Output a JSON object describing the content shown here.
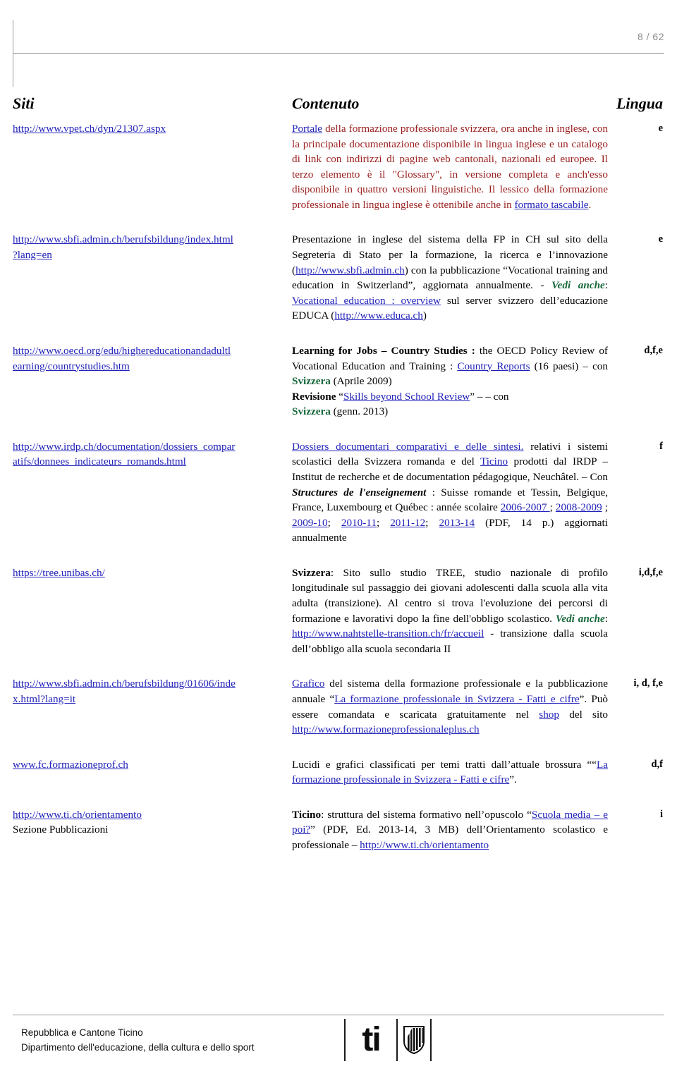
{
  "header": {
    "page_number": "8 / 62"
  },
  "table": {
    "columns": [
      "Siti",
      "Contenuto",
      "Lingua"
    ],
    "rows": [
      {
        "site": "http://www.vpet.ch/dyn/21307.aspx",
        "site_extra": "",
        "lingua": "e",
        "content_text": "Portale della formazione professionale svizzera, ora anche in inglese, con la principale documentazione disponibile in lingua inglese e un catalogo di link con indirizzi di pagine web cantonali, nazionali ed europee. Il terzo elemento è il \"Glossary\", in versione completa e anch'esso disponibile in quattro versioni linguistiche. Il lessico della formazione professionale in lingua inglese è ottenibile anche in formato tascabile.",
        "fragments": [
          {
            "t": "Portale",
            "s": "link"
          },
          {
            "t": " della formazione professionale svizzera, ora anche in inglese, con la principale documentazione disponibile in lingua inglese e un catalogo di link con indirizzi di pagine web cantonali, nazionali ed europee. Il terzo elemento è il \"Glossary\", in versione completa e anch'esso disponibile in quattro versioni linguistiche. Il lessico della formazione professionale in lingua inglese è ottenibile anche in ",
            "s": "red"
          },
          {
            "t": "formato tascabile",
            "s": "link"
          },
          {
            "t": ".",
            "s": "red"
          }
        ]
      },
      {
        "site": "http://www.sbfi.admin.ch/berufsbildung/index.html",
        "site_extra": "?lang=en",
        "lingua": "e",
        "fragments": [
          {
            "t": "Presentazione in inglese del sistema della FP in CH sul sito della Segreteria di Stato per la formazione, la ricerca e l’innovazione (",
            "s": "plain"
          },
          {
            "t": "http://www.sbfi.admin.ch",
            "s": "link"
          },
          {
            "t": ") con la pubblicazione “Vocational training and education in Switzerland”, aggiornata annualmente. - ",
            "s": "plain"
          },
          {
            "t": "Vedi anche",
            "s": "green-italic"
          },
          {
            "t": ": ",
            "s": "plain"
          },
          {
            "t": "Vocational education : overview",
            "s": "link"
          },
          {
            "t": " sul server svizzero dell’educazione EDUCA (",
            "s": "plain"
          },
          {
            "t": "http://www.educa.ch",
            "s": "link"
          },
          {
            "t": ")",
            "s": "plain"
          }
        ]
      },
      {
        "site": "http://www.oecd.org/edu/highereducationandadultl",
        "site_extra": "earning/countrystudies.htm",
        "lingua": "d,f,e",
        "fragments": [
          {
            "t": "Learning for Jobs – Country Studies :",
            "s": "bold"
          },
          {
            "t": " the OECD Policy Review of Vocational Education and Training : ",
            "s": "plain"
          },
          {
            "t": "Country Reports",
            "s": "link"
          },
          {
            "t": " (16 paesi)  – con ",
            "s": "plain"
          },
          {
            "t": "Svizzera",
            "s": "green-bold"
          },
          {
            "t": " (Aprile 2009)",
            "s": "plain"
          },
          {
            "t": "BR",
            "s": "br"
          },
          {
            "t": "Revisione ",
            "s": "bold"
          },
          {
            "t": "“",
            "s": "plain"
          },
          {
            "t": "Skills beyond School Review",
            "s": "link"
          },
          {
            "t": "” – – con ",
            "s": "plain"
          },
          {
            "t": "BR",
            "s": "br"
          },
          {
            "t": "Svizzera",
            "s": "green-bold"
          },
          {
            "t": " (genn. 2013)",
            "s": "plain"
          }
        ]
      },
      {
        "site": "http://www.irdp.ch/documentation/dossiers_compar",
        "site_extra": "atifs/donnees_indicateurs_romands.html",
        "lingua": "f",
        "fragments": [
          {
            "t": "Dossiers documentari comparativi e delle sintesi.",
            "s": "link"
          },
          {
            "t": " relativi i sistemi scolastici della Svizzera romanda e del ",
            "s": "plain"
          },
          {
            "t": "Ticino",
            "s": "link"
          },
          {
            "t": " prodotti dal IRDP – Institut de recherche et de documentation pédagogique, Neuchâtel. – Con ",
            "s": "plain"
          },
          {
            "t": "Structures de l'enseignement",
            "s": "bold-italic"
          },
          {
            "t": " : Suisse romande et Tessin, Belgique, France, Luxembourg et Québec : année scolaire ",
            "s": "plain"
          },
          {
            "t": "2006-2007 ",
            "s": "link"
          },
          {
            "t": "; ",
            "s": "plain"
          },
          {
            "t": "2008-2009",
            "s": "link"
          },
          {
            "t": " ; ",
            "s": "plain"
          },
          {
            "t": "2009-10",
            "s": "link"
          },
          {
            "t": "; ",
            "s": "plain"
          },
          {
            "t": "2010-11",
            "s": "link"
          },
          {
            "t": "; ",
            "s": "plain"
          },
          {
            "t": "2011-12",
            "s": "link"
          },
          {
            "t": "; ",
            "s": "plain"
          },
          {
            "t": "2013-14",
            "s": "link"
          },
          {
            "t": " (PDF, 14 p.) aggiornati annualmente",
            "s": "plain"
          }
        ]
      },
      {
        "site": "https://tree.unibas.ch/",
        "site_extra": "",
        "lingua": "i,d,f,e",
        "fragments": [
          {
            "t": "Svizzera",
            "s": "bold"
          },
          {
            "t": ": Sito sullo studio TREE, studio nazionale di profilo longitudinale sul passaggio dei giovani adolescenti dalla scuola alla vita adulta (transizione). Al centro si trova l'evoluzione dei percorsi di formazione e lavorativi dopo la fine dell'obbligo scolastico. ",
            "s": "plain"
          },
          {
            "t": "Vedi anche",
            "s": "green-italic"
          },
          {
            "t": ": ",
            "s": "plain"
          },
          {
            "t": "http://www.nahtstelle-transition.ch/fr/accueil",
            "s": "link"
          },
          {
            "t": " - transizione dalla scuola dell’obbligo alla scuola secondaria II",
            "s": "plain"
          }
        ]
      },
      {
        "site": "http://www.sbfi.admin.ch/berufsbildung/01606/inde",
        "site_extra": "x.html?lang=it",
        "lingua": "i, d, f,e",
        "fragments": [
          {
            "t": "Grafico",
            "s": "link"
          },
          {
            "t": " del sistema della formazione professionale e la pubblicazione annuale “",
            "s": "plain"
          },
          {
            "t": "La formazione professionale in Svizzera - Fatti e cifre",
            "s": "link"
          },
          {
            "t": "”. Può essere comandata e scaricata gratuitamente nel ",
            "s": "plain"
          },
          {
            "t": "shop",
            "s": "link"
          },
          {
            "t": " del sito ",
            "s": "plain"
          },
          {
            "t": "http://www.formazioneprofessionaleplus.ch",
            "s": "link"
          }
        ]
      },
      {
        "site": "www.fc.formazioneprof.ch",
        "site_extra": "",
        "lingua": "d,f",
        "fragments": [
          {
            "t": "Lucidi e grafici classificati per temi tratti dall’attuale brossura ““",
            "s": "plain"
          },
          {
            "t": "La formazione professionale in Svizzera - Fatti e cifre",
            "s": "link"
          },
          {
            "t": "”.",
            "s": "plain"
          }
        ]
      },
      {
        "site": "http://www.ti.ch/orientamento",
        "site_extra": "Sezione Pubblicazioni",
        "site_extra_plain": true,
        "lingua": "i",
        "fragments": [
          {
            "t": "Ticino",
            "s": "bold"
          },
          {
            "t": ": struttura del sistema formativo nell’opuscolo “",
            "s": "plain"
          },
          {
            "t": "Scuola media – e poi?",
            "s": "link"
          },
          {
            "t": "” (PDF, Ed. 2013-14, 3 MB) dell’Orientamento scolastico e professionale – ",
            "s": "plain"
          },
          {
            "t": "http://www.ti.ch/orientamento",
            "s": "link"
          }
        ]
      }
    ]
  },
  "footer": {
    "line1": "Repubblica e Cantone Ticino",
    "line2": "Dipartimento dell'educazione, della cultura e dello sport",
    "logo_wordmark": "ti"
  },
  "colors": {
    "link": "#2222bb",
    "body_red": "#9c2020",
    "accent_green": "#17683a",
    "rule": "#9a9a9a",
    "page_number": "#8d8d8d"
  }
}
